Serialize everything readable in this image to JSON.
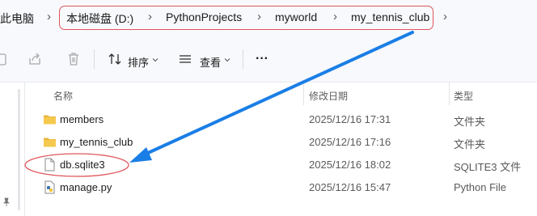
{
  "breadcrumb": {
    "items": [
      "此电脑",
      "本地磁盘 (D:)",
      "PythonProjects",
      "myworld",
      "my_tennis_club"
    ],
    "separator": "›"
  },
  "toolbar": {
    "sort_label": "排序",
    "view_label": "查看",
    "more_label": "···"
  },
  "columns": {
    "name": "名称",
    "modified": "修改日期",
    "type": "类型"
  },
  "files": [
    {
      "name": "members",
      "modified": "2025/12/16 17:31",
      "type": "文件夹",
      "icon": "folder-icon"
    },
    {
      "name": "my_tennis_club",
      "modified": "2025/12/16 17:16",
      "type": "文件夹",
      "icon": "folder-icon"
    },
    {
      "name": "db.sqlite3",
      "modified": "2025/12/16 18:02",
      "type": "SQLITE3 文件",
      "icon": "blank-file-icon"
    },
    {
      "name": "manage.py",
      "modified": "2025/12/16 15:47",
      "type": "Python File",
      "icon": "python-file-icon"
    }
  ],
  "annotation": {
    "color": "#1a7ee6",
    "highlight_color": "#e0565d"
  }
}
